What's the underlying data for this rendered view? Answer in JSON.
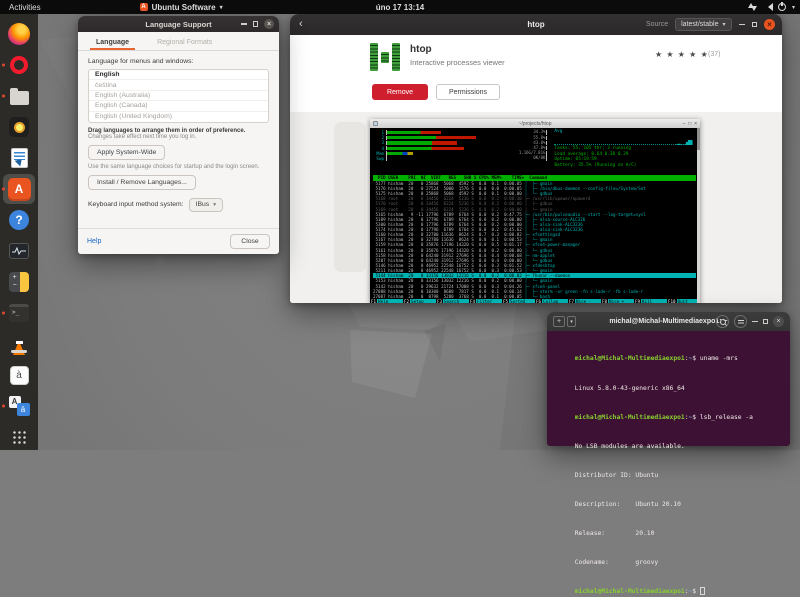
{
  "ui": {
    "chevron": "▾",
    "close": "×",
    "back": "‹",
    "plus": "+"
  },
  "topbar": {
    "activities": "Activities",
    "app_menu": "Ubuntu Software",
    "clock": "úno 17 13:14"
  },
  "dock": {
    "icons": [
      "firefox",
      "opera",
      "files",
      "rhythmbox",
      "libreoffice-writer",
      "ubuntu-software",
      "help",
      "system-monitor",
      "calculator",
      "terminal",
      "vlc",
      "characters",
      "language-support",
      "app-grid"
    ],
    "glyphs": {
      "software": "A",
      "help": "?",
      "terminal": ">_",
      "characters": "à",
      "lang_a": "A",
      "lang_b": "ä",
      "calc_plus": "+",
      "calc_minus": "−"
    }
  },
  "language_window": {
    "title": "Language Support",
    "tabs": [
      {
        "label": "Language"
      },
      {
        "label": "Regional Formats"
      }
    ],
    "menus_label": "Language for menus and windows:",
    "languages": [
      {
        "t": "English",
        "cls": "li-row sel"
      },
      {
        "t": "čeština",
        "cls": "li-row"
      },
      {
        "t": "English (Australia)",
        "cls": "li-row"
      },
      {
        "t": "English (Canada)",
        "cls": "li-row"
      },
      {
        "t": "English (United Kingdom)",
        "cls": "li-row"
      }
    ],
    "drag_note_bold": "Drag languages to arrange them in order of preference.",
    "drag_note": "Changes take effect next time you log in.",
    "apply_button": "Apply System-Wide",
    "systemwide_note": "Use the same language choices for startup and the login screen.",
    "install_button": "Install / Remove Languages...",
    "ime_label": "Keyboard input method system:",
    "ime_value": "IBus",
    "help_link": "Help",
    "close_button": "Close"
  },
  "software_window": {
    "title": "htop",
    "source_label": "Source",
    "source_value": "latest/stable",
    "app": {
      "name": "htop",
      "summary": "Interactive processes viewer",
      "stars": "★ ★ ★ ★ ★",
      "rating_count": "(37)"
    },
    "remove_button": "Remove",
    "permissions_button": "Permissions",
    "screenshot": {
      "xterm_title": "~/projects/htop",
      "controls": "–  □  ×",
      "meters": [
        {
          "lab": "1",
          "txt": "34.3%",
          "style": "width:34%;background:linear-gradient(90deg,#00a800 0 62%,#c01800 62% 100%)"
        },
        {
          "lab": "2",
          "txt": "55.8%",
          "style": "width:56%;background:linear-gradient(90deg,#00a800 0 55%,#c01800 55% 100%)"
        },
        {
          "lab": "3",
          "txt": "43.8%",
          "style": "width:44%;background:linear-gradient(90deg,#00a800 0 64%,#c01800 64% 100%)"
        },
        {
          "lab": "4",
          "txt": "47.8%",
          "style": "width:48%;background:linear-gradient(90deg,#00a800 0 58%,#c01800 58% 100%)"
        },
        {
          "lab": "Mem",
          "txt": "1.16G/7.81G",
          "style": "width:16%;background:linear-gradient(90deg,#00a800 0 60%,#0040c0 60% 78%,#b0a000 78% 100%)"
        },
        {
          "lab": "Swp",
          "txt": "0K/0K",
          "style": "width:0%"
        }
      ],
      "avg_label": "Avg",
      "avg_tail": "▁▂▁ ▁▅██",
      "stats": [
        "Tasks: 55, 105 thr; 3 running",
        "Load average: 0.64 0.30 0.29",
        "Uptime: 05:19:59",
        "Battery: 35.5% (Running on A/C)"
      ],
      "header": "  PID USER    PRI  NI  VIRT   RES   SHR S CPU% MEM%    TIME+  Command",
      "rows": [
        {
          "cls": "hrow",
          "m": " 5177 hisham  20   0 25868  5068  4592 S  0.0  0.1  0:00.05",
          "c": "│  ├─ gmain"
        },
        {
          "cls": "hrow",
          "m": " 5176 hisham  20   0 27524  5000  1576 S  0.0  0.0  0:00.05",
          "c": "│  ├─ /bin/dbus-daemon --config-file=/System/Set"
        },
        {
          "cls": "hrow",
          "m": " 5175 hisham  20   0 25868  5068  4592 S  0.0  0.1  0:00.00",
          "c": "│  └─ gdbus"
        },
        {
          "cls": "hrow dim",
          "m": " 5168 root    20   0 34456  6224  5236 S  0.0  0.2  0:00.30",
          "c": "├─ /usr/lib/upower/upowerd"
        },
        {
          "cls": "hrow dim",
          "m": " 5170 root    20   0 34456  6224  5236 S  0.0  0.2  0:00.00",
          "c": "│  ├─ gdbus"
        },
        {
          "cls": "hrow dim",
          "m": " 5169 root    20   0 34456  6224  5236 S  0.0  0.2  0:00.00",
          "c": "│  └─ gmain"
        },
        {
          "cls": "hrow",
          "m": " 5165 hisham   9 -11 17796  6789  6764 S  0.0  0.2  0:47.75",
          "c": "├─ /usr/bin/pulseaudio --start --log-target=sysl"
        },
        {
          "cls": "hrow",
          "m": " 5189 hisham  20   0 17796  6789  6764 S  0.0  0.2  0:00.00",
          "c": "│  ├─ alsa-source-ALC326"
        },
        {
          "cls": "hrow",
          "m": " 5300 hisham  20   0 17796  6789  6764 S  0.0  0.2  0:00.00",
          "c": "│  ├─ alsa-sink-ALC3236"
        },
        {
          "cls": "hrow",
          "m": " 5174 hisham  20   0 17796  6789  6764 S  0.0  0.2  0:45.62",
          "c": "│  └─ alsa-sink-ALC3236"
        },
        {
          "cls": "hrow",
          "m": " 5160 hisham  20   0 32780 11636  8624 S  0.7  0.3  0:00.82",
          "c": "├─ xfsettingsd"
        },
        {
          "cls": "hrow",
          "m": " 5167 hisham  20   0 32780 11636  8624 S  0.0  0.1  0:00.53",
          "c": "│  └─ gmain"
        },
        {
          "cls": "hrow",
          "m": " 5159 hisham  20   0 35876 17196 14320 S  0.0  0.5  0:01.17",
          "c": "├─ xfce4-power-manager"
        },
        {
          "cls": "hrow",
          "m": " 5161 hisham  20   0 35876 17196 14320 S  0.0  0.2  0:00.00",
          "c": "│  └─ gdbus"
        },
        {
          "cls": "hrow",
          "m": " 5158 hisham  20   0 64240 31912 27696 S  0.0  0.4  0:00.68",
          "c": "├─ nm-applet"
        },
        {
          "cls": "hrow",
          "m": " 5207 hisham  20   0 64240 31912 27696 S  0.0  0.4  0:00.00",
          "c": "│  └─ gdbus"
        },
        {
          "cls": "hrow",
          "m": " 5146 hisham  20   0 46952 22548 16752 S  0.0  0.3  0:01.52",
          "c": "├─ xfdesktop"
        },
        {
          "cls": "hrow",
          "m": " 5211 hisham  20   0 46952 22548 16752 S  0.0  0.3  0:00.53",
          "c": "│  └─ gmain"
        },
        {
          "cls": "hrow sel",
          "m": " 5144 hisham  20   0 33156 13032 12216 S  0.0  0.2  0:00.02",
          "c": "├─ Thunar --daemon"
        },
        {
          "cls": "hrow",
          "m": " 5153 hisham  20   0 33156 13032 12216 S  0.0  0.2  0:00.00",
          "c": "│  └─ gmain"
        },
        {
          "cls": "hrow",
          "m": " 5142 hisham  20   0 29632 21724 17008 S  0.0  0.3  0:04.26",
          "c": "├─ xfce4-panel"
        },
        {
          "cls": "hrow",
          "m": "27088 hisham  20   0 10300  8688  7817 S  0.0  0.1  0:00.14",
          "c": "│  ├─ xterm -xr green -fn s-lode-r -fb s-lode-r"
        },
        {
          "cls": "hrow",
          "m": "27087 hisham  20   0  8798  5280  3768 S  0.0  0.1  0:00.05",
          "c": "│  └─ bash"
        }
      ],
      "fkeys": [
        {
          "k": "F1",
          "l": "Help"
        },
        {
          "k": "F2",
          "l": "Setup"
        },
        {
          "k": "F3",
          "l": "Search"
        },
        {
          "k": "F4",
          "l": "Filter"
        },
        {
          "k": "F5",
          "l": "Sorted"
        },
        {
          "k": "F6",
          "l": "Collap"
        },
        {
          "k": "F7",
          "l": "Nice -"
        },
        {
          "k": "F8",
          "l": "Nice +"
        },
        {
          "k": "F9",
          "l": "Kill"
        },
        {
          "k": "F10",
          "l": "Quit"
        }
      ]
    }
  },
  "terminal_window": {
    "title": "michal@Michal-Multimediaexpo1: ~",
    "lines": [
      [
        [
          "sg",
          "michal@Michal-Multimediaexpo1"
        ],
        [
          "sw",
          ":"
        ],
        [
          "sb",
          "~"
        ],
        [
          "sw",
          "$ uname -mrs"
        ]
      ],
      [
        [
          "sw",
          "Linux 5.8.0-43-generic x86_64"
        ]
      ],
      [
        [
          "sg",
          "michal@Michal-Multimediaexpo1"
        ],
        [
          "sw",
          ":"
        ],
        [
          "sb",
          "~"
        ],
        [
          "sw",
          "$ lsb_release -a"
        ]
      ],
      [
        [
          "sw",
          "No LSB modules are available."
        ]
      ],
      [
        [
          "sw",
          "Distributor ID: Ubuntu"
        ]
      ],
      [
        [
          "sw",
          "Description:    Ubuntu 20.10"
        ]
      ],
      [
        [
          "sw",
          "Release:        20.10"
        ]
      ],
      [
        [
          "sw",
          "Codename:       groovy"
        ]
      ],
      [
        [
          "sg",
          "michal@Michal-Multimediaexpo1"
        ],
        [
          "sw",
          ":"
        ],
        [
          "sb",
          "~"
        ],
        [
          "sw",
          "$ "
        ],
        [
          "cur",
          ""
        ]
      ]
    ]
  }
}
